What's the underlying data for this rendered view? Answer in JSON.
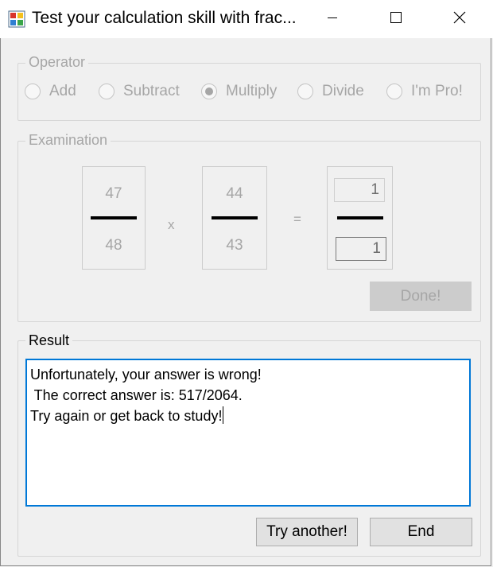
{
  "window": {
    "title": "Test your calculation skill with frac...",
    "controls": {
      "minimize_icon": "minimize-icon",
      "maximize_icon": "maximize-icon",
      "close_icon": "close-icon"
    }
  },
  "operator": {
    "legend": "Operator",
    "options": [
      {
        "label": "Add",
        "selected": false
      },
      {
        "label": "Subtract",
        "selected": false
      },
      {
        "label": "Multiply",
        "selected": true
      },
      {
        "label": "Divide",
        "selected": false
      },
      {
        "label": "I'm Pro!",
        "selected": false
      }
    ]
  },
  "examination": {
    "legend": "Examination",
    "fraction1": {
      "numerator": "47",
      "denominator": "48"
    },
    "operator_symbol": "x",
    "fraction2": {
      "numerator": "44",
      "denominator": "43"
    },
    "equals_symbol": "=",
    "answer": {
      "numerator": "1",
      "denominator": "1"
    },
    "done_label": "Done!"
  },
  "result": {
    "legend": "Result",
    "lines": [
      "Unfortunately, your answer is wrong!",
      " The correct answer is: 517/2064.",
      "",
      "Try again or get back to study!"
    ],
    "try_another_label": "Try another!",
    "end_label": "End"
  },
  "colors": {
    "accent": "#0078d7",
    "disabled_text": "#a6a6a6"
  }
}
